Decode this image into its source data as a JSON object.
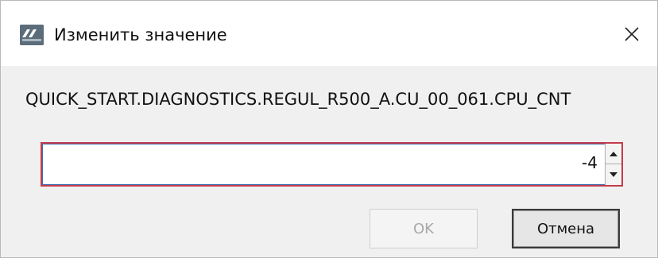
{
  "window": {
    "title": "Изменить значение",
    "icon": "app-logo-icon",
    "close_icon": "close-icon"
  },
  "dialog": {
    "tag_path": "QUICK_START.DIAGNOSTICS.REGUL_R500_A.CU_00_061.CPU_CNT",
    "value": "-4",
    "ok_label": "OK",
    "cancel_label": "Отмена"
  },
  "colors": {
    "focus_border": "#c43c4b",
    "inner_border": "#3c6fb4",
    "disabled_text": "#a8a8a8"
  }
}
